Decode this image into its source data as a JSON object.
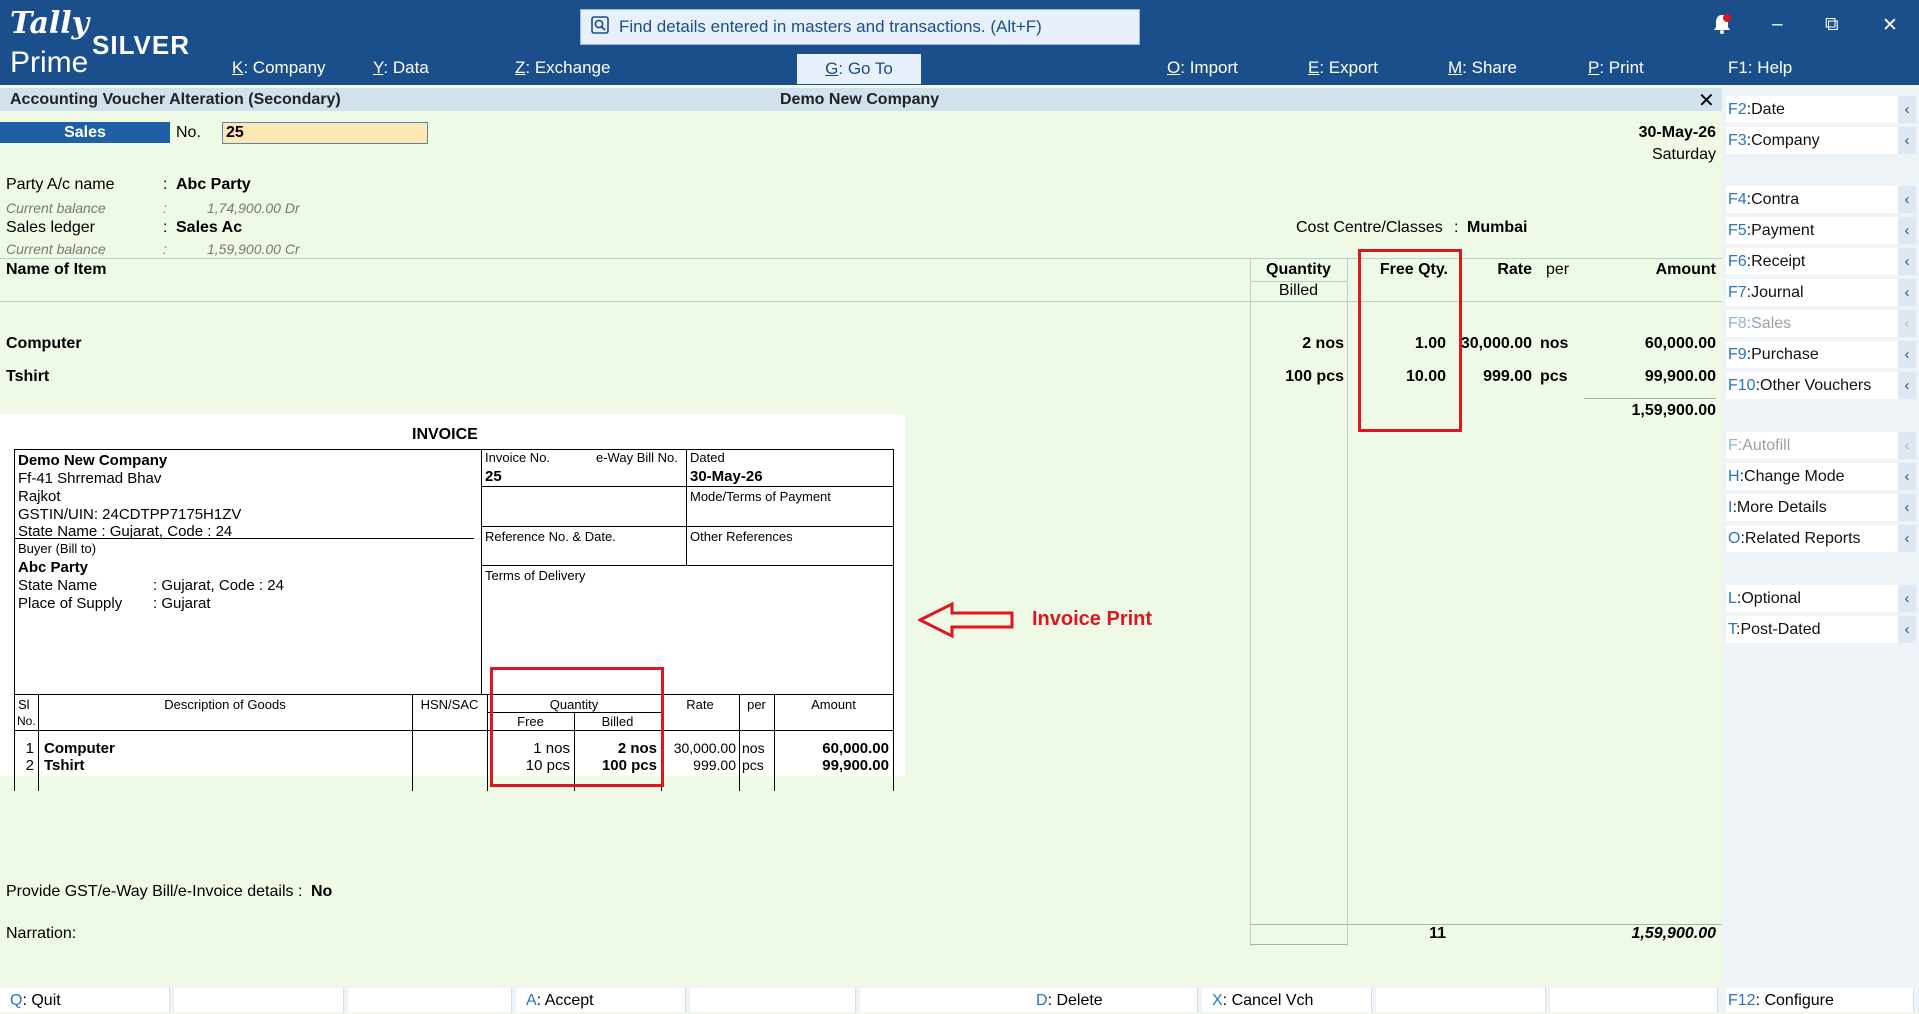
{
  "app": {
    "logo_top": "Tally",
    "logo_bottom": "Prime",
    "edition": "SILVER"
  },
  "search": {
    "placeholder": "Find details entered in masters and transactions. (Alt+F)"
  },
  "menu": [
    {
      "key": "K",
      "label": "Company"
    },
    {
      "key": "Y",
      "label": "Data"
    },
    {
      "key": "Z",
      "label": "Exchange"
    },
    {
      "key": "G",
      "label": "Go To"
    },
    {
      "key": "O",
      "label": "Import"
    },
    {
      "key": "E",
      "label": "Export"
    },
    {
      "key": "M",
      "label": "Share"
    },
    {
      "key": "P",
      "label": "Print"
    },
    {
      "key": "F1",
      "label": "Help"
    }
  ],
  "window_controls": {
    "minimize": "–",
    "restore": "⧉",
    "close": "✕",
    "close_form": "✕"
  },
  "subheader": {
    "title": "Accounting Voucher Alteration (Secondary)",
    "company": "Demo New Company"
  },
  "voucher": {
    "type": "Sales",
    "no_label": "No.",
    "no_value": "25",
    "date": "30-May-26",
    "day": "Saturday",
    "party_label": "Party A/c name",
    "party_value": "Abc Party",
    "cur_bal_label": "Current balance",
    "party_balance": "1,74,900.00 Dr",
    "sales_ledger_label": "Sales ledger",
    "sales_ledger_value": "Sales Ac",
    "sales_balance": "1,59,900.00 Cr",
    "cost_centre_label": "Cost Centre/Classes",
    "cost_centre_value": "Mumbai",
    "colon": ":"
  },
  "table": {
    "headers": {
      "item": "Name of Item",
      "quantity": "Quantity",
      "billed": "Billed",
      "free_qty": "Free Qty.",
      "rate": "Rate",
      "per": "per",
      "amount": "Amount"
    },
    "rows": [
      {
        "item": "Computer",
        "qty": "2 nos",
        "free": "1.00",
        "rate": "30,000.00",
        "per": "nos",
        "amount": "60,000.00"
      },
      {
        "item": "Tshirt",
        "qty": "100 pcs",
        "free": "10.00",
        "rate": "999.00",
        "per": "pcs",
        "amount": "99,900.00"
      }
    ],
    "subtotal": "1,59,900.00",
    "total_qty": "11",
    "total_amount": "1,59,900.00"
  },
  "gst": {
    "label": "Provide GST/e-Way Bill/e-Invoice details",
    "colon": ":",
    "value": "No"
  },
  "narration": {
    "label": "Narration:"
  },
  "annotation": {
    "label": "Invoice Print"
  },
  "invoice": {
    "title": "INVOICE",
    "company_name": "Demo New Company",
    "address1": "Ff-41 Shrremad Bhav",
    "address2": "Rajkot",
    "gstin": "GSTIN/UIN: 24CDTPP7175H1ZV",
    "state": "State Name :  Gujarat, Code : 24",
    "invoice_no_label": "Invoice No.",
    "eway_label": "e-Way Bill No.",
    "dated_label": "Dated",
    "invoice_no": "25",
    "dated": "30-May-26",
    "mode_label": "Mode/Terms of Payment",
    "ref_label": "Reference No. & Date.",
    "other_ref_label": "Other References",
    "buyer_label": "Buyer (Bill to)",
    "buyer_name": "Abc Party",
    "buyer_state_label": "State Name",
    "buyer_state": ":  Gujarat, Code : 24",
    "pos_label": "Place of Supply",
    "pos": ":  Gujarat",
    "terms_label": "Terms of Delivery",
    "col_si": "Sl",
    "col_no": "No.",
    "col_desc": "Description of Goods",
    "col_hsn": "HSN/SAC",
    "col_qty": "Quantity",
    "col_free": "Free",
    "col_billed": "Billed",
    "col_rate": "Rate",
    "col_per": "per",
    "col_amount": "Amount",
    "rows": [
      {
        "sl": "1",
        "desc": "Computer",
        "free": "1 nos",
        "billed": "2 nos",
        "rate": "30,000.00",
        "per": "nos",
        "amount": "60,000.00"
      },
      {
        "sl": "2",
        "desc": "Tshirt",
        "free": "10 pcs",
        "billed": "100 pcs",
        "rate": "999.00",
        "per": "pcs",
        "amount": "99,900.00"
      }
    ]
  },
  "right_buttons": [
    {
      "key": "F2",
      "label": "Date",
      "enabled": true
    },
    {
      "key": "F3",
      "label": "Company",
      "enabled": true
    },
    {
      "key": "F4",
      "label": "Contra",
      "enabled": true
    },
    {
      "key": "F5",
      "label": "Payment",
      "enabled": true
    },
    {
      "key": "F6",
      "label": "Receipt",
      "enabled": true
    },
    {
      "key": "F7",
      "label": "Journal",
      "enabled": true
    },
    {
      "key": "F8",
      "label": "Sales",
      "enabled": false
    },
    {
      "key": "F9",
      "label": "Purchase",
      "enabled": true
    },
    {
      "key": "F10",
      "label": "Other Vouchers",
      "enabled": true
    },
    {
      "key": "F",
      "label": "Autofill",
      "enabled": false
    },
    {
      "key": "H",
      "label": "Change Mode",
      "enabled": true
    },
    {
      "key": "I",
      "label": "More Details",
      "enabled": true
    },
    {
      "key": "O",
      "label": "Related Reports",
      "enabled": true
    },
    {
      "key": "L",
      "label": "Optional",
      "enabled": true
    },
    {
      "key": "T",
      "label": "Post-Dated",
      "enabled": true
    }
  ],
  "bottom_buttons": [
    {
      "key": "Q",
      "label": "Quit"
    },
    {
      "key": "A",
      "label": "Accept"
    },
    {
      "key": "D",
      "label": "Delete"
    },
    {
      "key": "X",
      "label": "Cancel Vch"
    }
  ],
  "configure": {
    "key": "F12",
    "label": "Configure"
  },
  "icons": {
    "arrow": "‹",
    "bell": "bell-icon",
    "search": "search-icon"
  }
}
